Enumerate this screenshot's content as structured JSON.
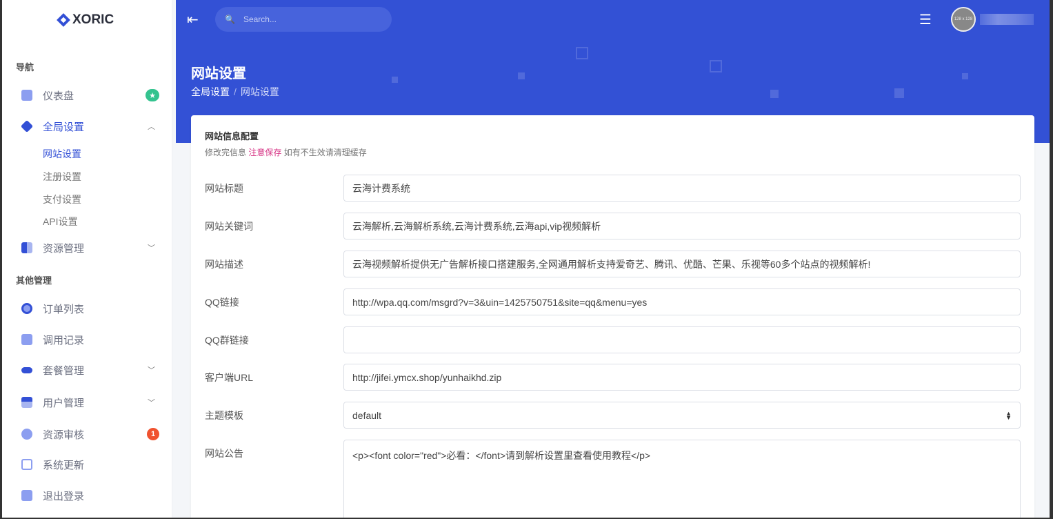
{
  "brand": "XORIC",
  "sidebar": {
    "section_nav": "导航",
    "section_other": "其他管理",
    "items": [
      {
        "label": "仪表盘",
        "badge": "★"
      },
      {
        "label": "全局设置"
      },
      {
        "label": "资源管理"
      },
      {
        "label": "订单列表"
      },
      {
        "label": "调用记录"
      },
      {
        "label": "套餐管理"
      },
      {
        "label": "用户管理"
      },
      {
        "label": "资源审核",
        "badge": "1"
      },
      {
        "label": "系统更新"
      },
      {
        "label": "退出登录"
      }
    ],
    "sub_items": [
      "网站设置",
      "注册设置",
      "支付设置",
      "API设置"
    ]
  },
  "topbar": {
    "search_placeholder": "Search...",
    "avatar_text": "128 x 128"
  },
  "page": {
    "title": "网站设置",
    "breadcrumb": [
      "全局设置",
      "网站设置"
    ]
  },
  "card": {
    "title": "网站信息配置",
    "subtitle_pre": "修改完信息",
    "subtitle_warn": "注意保存",
    "subtitle_post": "如有不生效请清理缓存",
    "fields": [
      {
        "label": "网站标题",
        "value": "云海计费系统"
      },
      {
        "label": "网站关键词",
        "value": "云海解析,云海解析系统,云海计费系统,云海api,vip视频解析"
      },
      {
        "label": "网站描述",
        "value": "云海视频解析提供无广告解析接口搭建服务,全网通用解析支持爱奇艺、腾讯、优酷、芒果、乐视等60多个站点的视频解析!"
      },
      {
        "label": "QQ链接",
        "value": "http://wpa.qq.com/msgrd?v=3&uin=1425750751&site=qq&menu=yes"
      },
      {
        "label": "QQ群链接",
        "value": ""
      },
      {
        "label": "客户端URL",
        "value": "http://jifei.ymcx.shop/yunhaikhd.zip"
      },
      {
        "label": "主题模板",
        "value": "default"
      },
      {
        "label": "网站公告",
        "value": "<p><font color=\"red\">必看：</font>请到解析设置里查看使用教程</p>"
      }
    ]
  },
  "colors": {
    "primary": "#3351d5",
    "success": "#34c38f",
    "danger": "#f46a6a",
    "warn": "#d63384"
  }
}
